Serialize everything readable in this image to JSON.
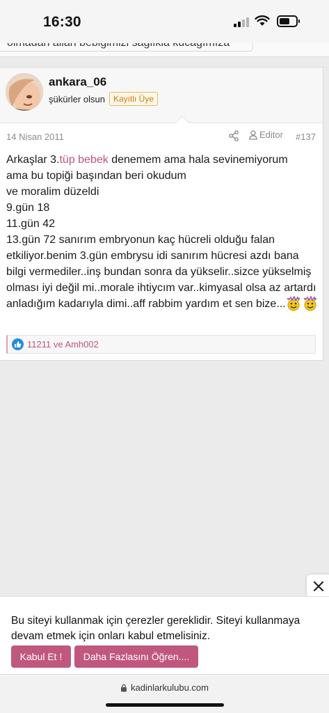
{
  "status_bar": {
    "time": "16:30"
  },
  "previous_post": {
    "text_fragment": "olmadan allah bebiğimizi sağlıkla kucağımıza"
  },
  "post": {
    "author": {
      "username": "ankara_06",
      "user_title": "şükürler olsun",
      "badge": "Kayıtlı Üye"
    },
    "meta": {
      "date": "14 Nisan 2011",
      "editor_label": "Editor",
      "post_number": "#137"
    },
    "body": {
      "intro": "Arkaşlar 3.",
      "link_text": "tüp bebek",
      "line1_rest": " denemem ama hala sevinemiyorum",
      "line2": "ama bu topiği başından beri okudum",
      "line3": "ve moralim düzeldi",
      "line4": "9.gün 18",
      "line5": "11.gün 42",
      "line6": "13.gün 72 sanırım embryonun kaç hücreli olduğu falan etkiliyor.benim 3.gün embrysu idi sanırım hücresi azdı bana bilgi vermediler..inş bundan sonra da yükselir..sizce yükselmiş olması iyi değil mi..morale ihtiycım var..kimyasal olsa az artardı anladığım kadarıyla dimi..aff rabbim yardım et sen bize..."
    },
    "reactions": {
      "names": "11211 ve Amh002"
    }
  },
  "cookie_banner": {
    "message": "Bu siteyi kullanmak için çerezler gereklidir. Siteyi kullanmaya devam etmek için onları kabul etmelisiniz.",
    "accept_label": "Kabul Et !",
    "more_label": "Daha Fazlasını Öğren...."
  },
  "browser": {
    "url": "kadinlarkulubu.com"
  },
  "colors": {
    "accent": "#c0587d",
    "link": "#c2537b",
    "badge": "#c97a1c",
    "like": "#1d8de6"
  },
  "icons": [
    "share-icon",
    "user-icon",
    "thumbs-up-icon",
    "close-icon",
    "lock-icon",
    "wifi-icon",
    "battery-icon",
    "signal-icon",
    "party-emoji-icon"
  ]
}
